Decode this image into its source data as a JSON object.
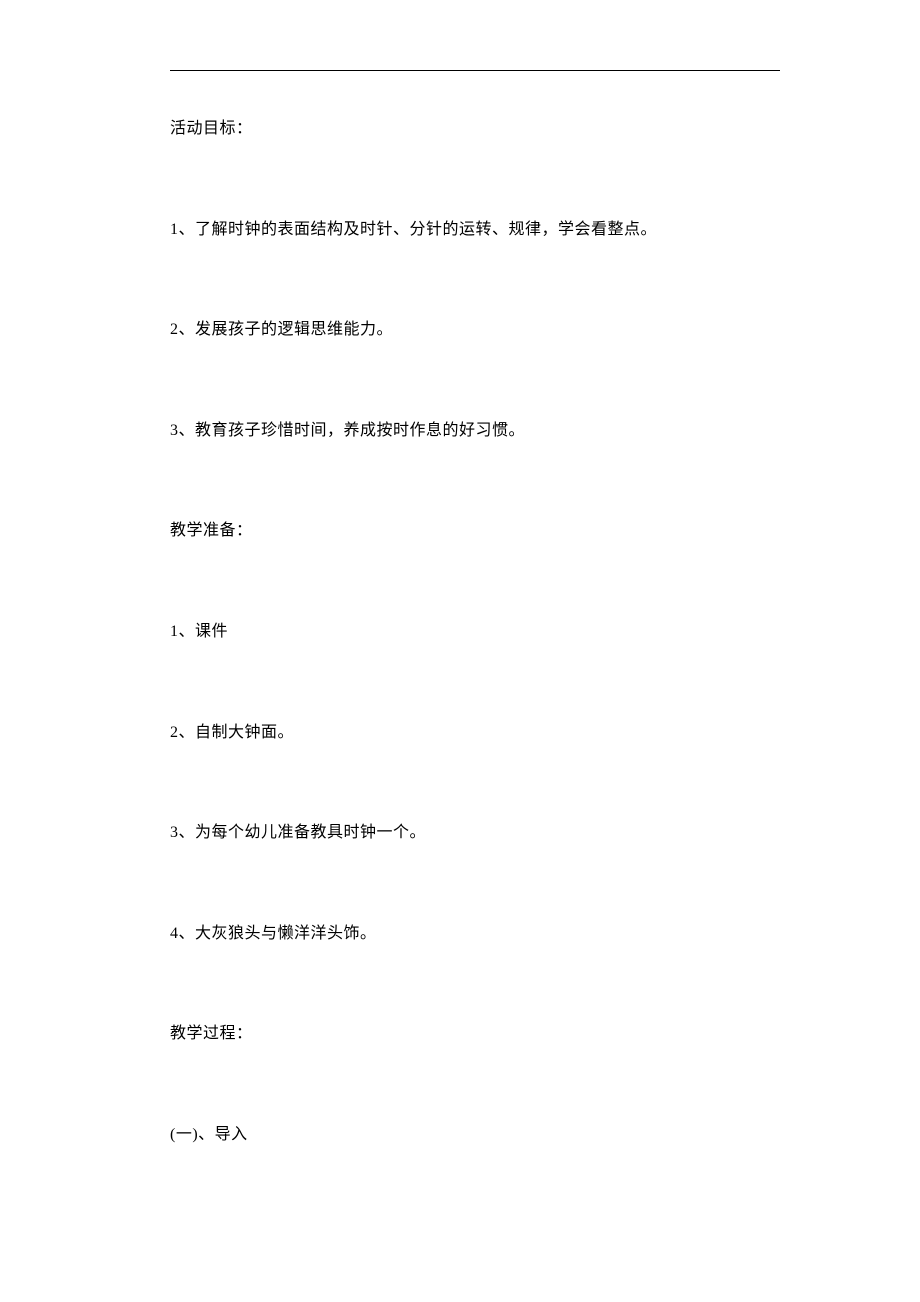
{
  "sections": {
    "goals": {
      "title": "活动目标：",
      "items": [
        "1、了解时钟的表面结构及时针、分针的运转、规律，学会看整点。",
        "2、发展孩子的逻辑思维能力。",
        "3、教育孩子珍惜时间，养成按时作息的好习惯。"
      ]
    },
    "preparation": {
      "title": "教学准备：",
      "items": [
        "1、课件",
        "2、自制大钟面。",
        "3、为每个幼儿准备教具时钟一个。",
        "4、大灰狼头与懒洋洋头饰。"
      ]
    },
    "process": {
      "title": "教学过程：",
      "items": [
        "(一)、导入"
      ]
    }
  }
}
